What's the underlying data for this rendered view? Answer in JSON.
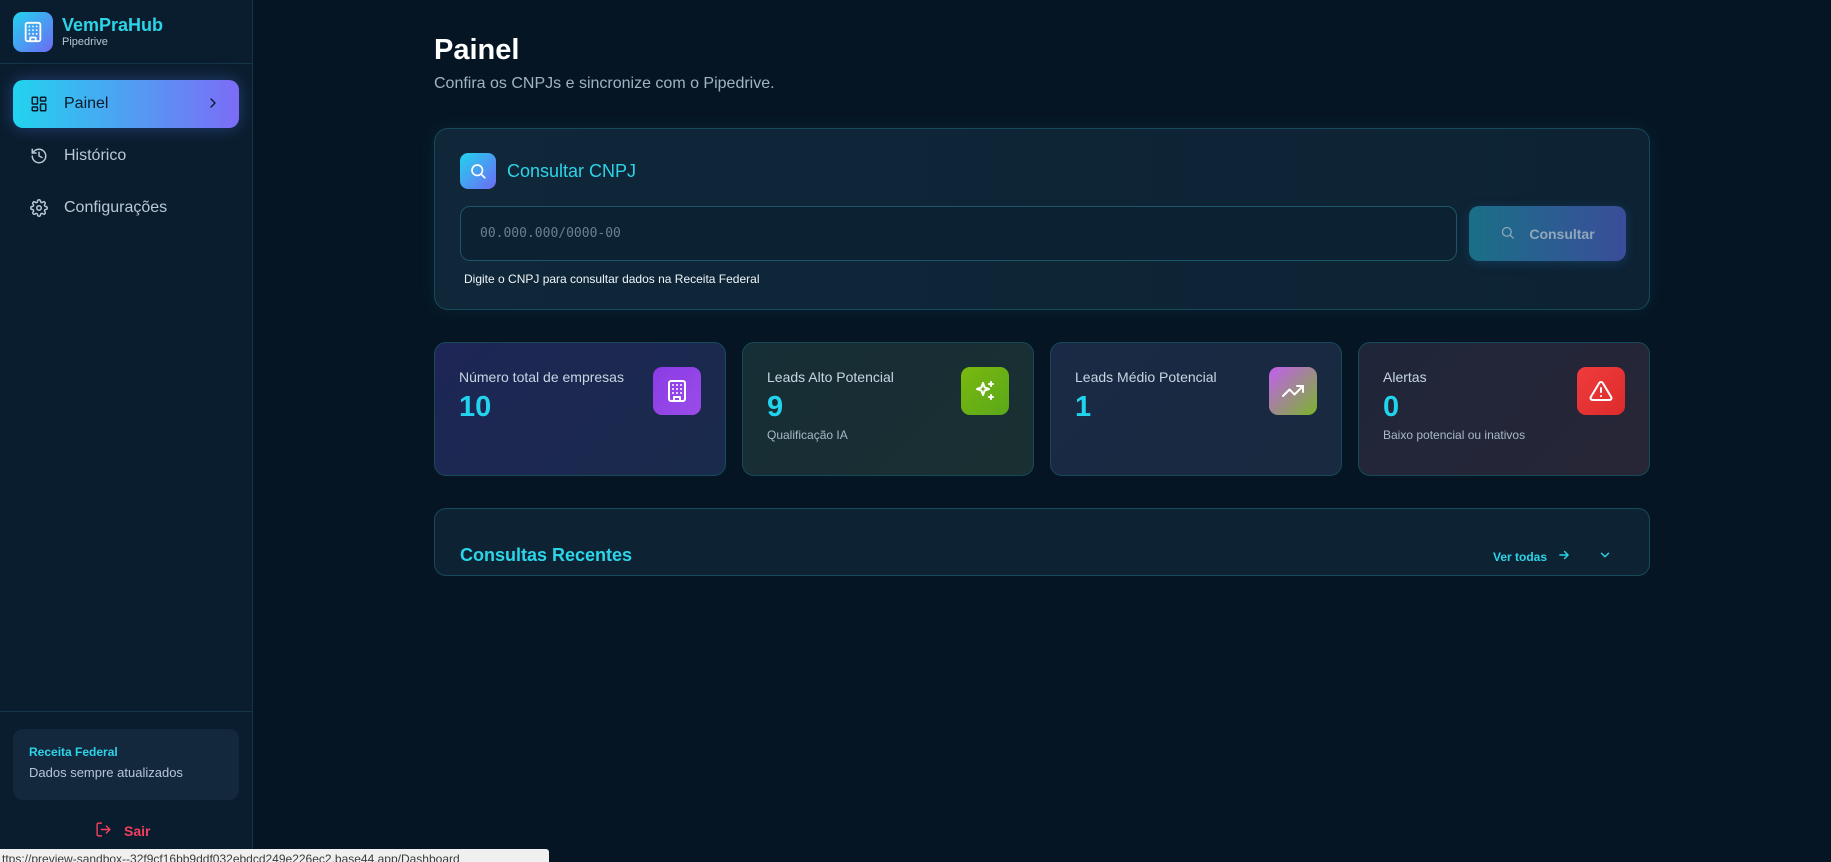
{
  "sidebar": {
    "brand_name": "VemPraHub",
    "brand_sub": "Pipedrive",
    "items": [
      {
        "label": "Painel",
        "icon": "grid-icon",
        "active": true
      },
      {
        "label": "Histórico",
        "icon": "history-icon",
        "active": false
      },
      {
        "label": "Configurações",
        "icon": "gear-icon",
        "active": false
      }
    ],
    "info_card": {
      "title": "Receita Federal",
      "subtitle": "Dados sempre atualizados"
    },
    "logout_label": "Sair"
  },
  "status_bar": {
    "url": "ttps://preview-sandbox--32f9cf16bb9ddf032ebdcd249e226ec2.base44.app/Dashboard"
  },
  "main": {
    "title": "Painel",
    "subtitle": "Confira os CNPJs e sincronize com o Pipedrive.",
    "cnpj": {
      "title": "Consultar CNPJ",
      "placeholder": "00.000.000/0000-00",
      "value": "",
      "button_label": "Consultar",
      "hint": "Digite o CNPJ para consultar dados na Receita Federal"
    },
    "stats": [
      {
        "label": "Número total de empresas",
        "value": "10",
        "caption": "",
        "icon": "building-icon"
      },
      {
        "label": "Leads Alto Potencial",
        "value": "9",
        "caption": "Qualificação IA",
        "icon": "sparkles-icon"
      },
      {
        "label": "Leads Médio Potencial",
        "value": "1",
        "caption": "",
        "icon": "trending-up-icon"
      },
      {
        "label": "Alertas",
        "value": "0",
        "caption": "Baixo potencial ou inativos",
        "icon": "alert-triangle-icon"
      }
    ],
    "recent": {
      "title": "Consultas Recentes",
      "link_label": "Ver todas"
    }
  },
  "colors": {
    "accent": "#22d3ee",
    "background": "#061523",
    "sidebar": "#0a1d2e",
    "danger": "#f43f5e"
  }
}
